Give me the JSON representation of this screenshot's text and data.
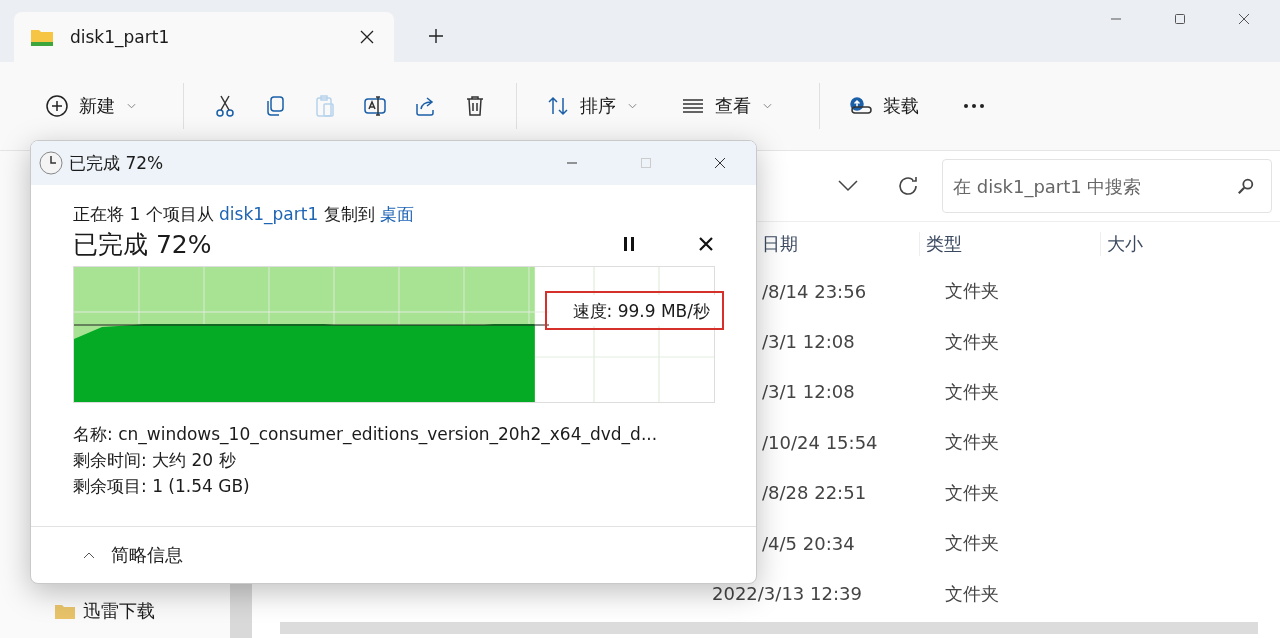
{
  "tab": {
    "title": "disk1_part1"
  },
  "toolbar": [
    {
      "kind": "new",
      "label": "新建",
      "dropdown": true,
      "disabled": false
    },
    {
      "kind": "separator"
    },
    {
      "kind": "cut",
      "disabled": false
    },
    {
      "kind": "copy",
      "disabled": false
    },
    {
      "kind": "paste",
      "disabled": true
    },
    {
      "kind": "rename",
      "disabled": false
    },
    {
      "kind": "share",
      "disabled": false
    },
    {
      "kind": "delete",
      "disabled": false
    },
    {
      "kind": "separator"
    },
    {
      "kind": "sort",
      "label": "排序",
      "dropdown": true,
      "disabled": false
    },
    {
      "kind": "view",
      "label": "查看",
      "dropdown": true,
      "disabled": false
    },
    {
      "kind": "separator"
    },
    {
      "kind": "mount",
      "label": "装载",
      "dropdown": false,
      "disabled": false
    },
    {
      "kind": "more",
      "disabled": false
    }
  ],
  "search": {
    "placeholder": "在 disk1_part1 中搜索"
  },
  "sidebar": {
    "items": [
      {
        "label": "迅雷下载"
      }
    ]
  },
  "table": {
    "columns": [
      "日期",
      "类型",
      "大小"
    ],
    "rows": [
      {
        "date": "/8/14 23:56",
        "type": "文件夹",
        "full": false
      },
      {
        "date": "/3/1 12:08",
        "type": "文件夹",
        "full": false
      },
      {
        "date": "/3/1 12:08",
        "type": "文件夹",
        "full": false
      },
      {
        "date": "/10/24 15:54",
        "type": "文件夹",
        "full": false
      },
      {
        "date": "/8/28 22:51",
        "type": "文件夹",
        "full": false
      },
      {
        "date": "/4/5 20:34",
        "type": "文件夹",
        "full": false
      },
      {
        "date": "2022/3/13 12:39",
        "type": "文件夹",
        "full": true
      }
    ]
  },
  "dialog": {
    "title": "已完成 72%",
    "message": {
      "before": "正在将 1 个项目从 ",
      "source": "disk1_part1",
      "middle": " 复制到 ",
      "target": "桌面"
    },
    "heading": "已完成 72%",
    "progress": {
      "level": 0.72,
      "speed": "速度: 99.9 MB/秒",
      "highlighted": true
    },
    "details": [
      "名称: cn_windows_10_consumer_editions_version_20h2_x64_dvd_d...",
      "剩余时间: 大约 20 秒",
      "剩余项目: 1 (1.54 GB)"
    ],
    "footer": "简略信息"
  }
}
